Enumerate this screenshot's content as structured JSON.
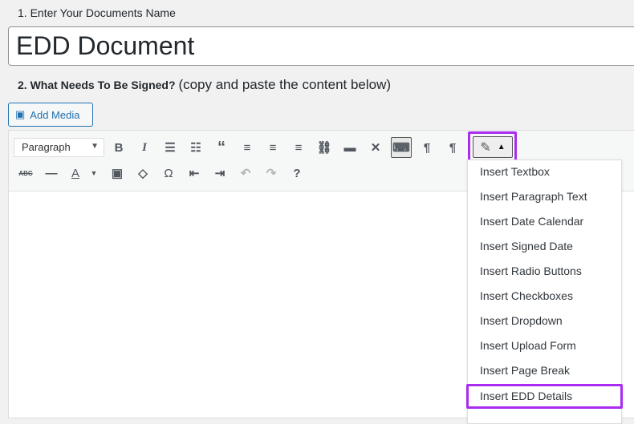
{
  "labels": {
    "doc_name": "1. Enter Your Documents Name",
    "what_signed": "2. What Needs To Be Signed?",
    "what_signed_hint": "(copy and paste the content below)"
  },
  "title_value": "EDD Document",
  "add_media": "Add Media",
  "format_select": "Paragraph",
  "menu": [
    "Insert Textbox",
    "Insert Paragraph Text",
    "Insert Date Calendar",
    "Insert Signed Date",
    "Insert Radio Buttons",
    "Insert Checkboxes",
    "Insert Dropdown",
    "Insert Upload Form",
    "Insert Page Break",
    "Insert EDD Details"
  ],
  "icons": {
    "strike": "ABC",
    "omega": "Ω",
    "font_color": "A"
  },
  "colors": {
    "highlight": "#a92cf0",
    "accent": "#2271b1"
  }
}
